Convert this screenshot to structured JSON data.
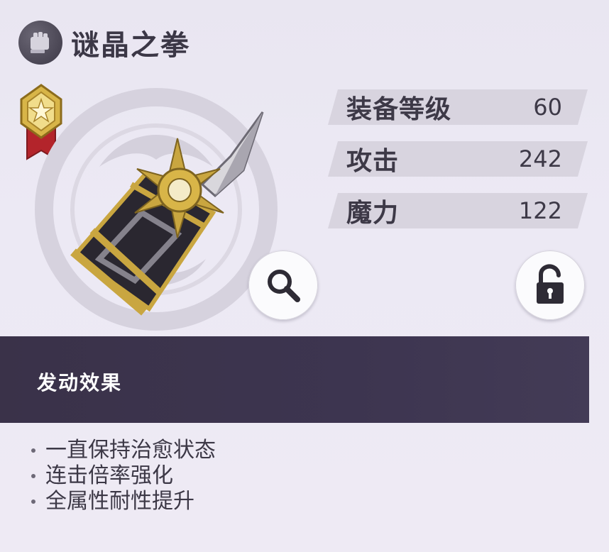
{
  "item": {
    "name": "谜晶之拳",
    "category_icon": "gauntlet-icon",
    "rank_icon": "star-rank-badge"
  },
  "stats": [
    {
      "label": "装备等级",
      "value": "60"
    },
    {
      "label": "攻击",
      "value": "242"
    },
    {
      "label": "魔力",
      "value": "122"
    }
  ],
  "buttons": {
    "zoom_icon": "magnifier-icon",
    "lock_icon": "padlock-open-icon"
  },
  "effect": {
    "title": "发动效果",
    "lines": [
      "一直保持治愈状态",
      "连击倍率强化",
      "全属性耐性提升"
    ]
  },
  "colors": {
    "header_band": "#3a3249",
    "stat_bar": "#d8d4df",
    "gold": "#c9a640",
    "badge_red": "#b3242b"
  }
}
